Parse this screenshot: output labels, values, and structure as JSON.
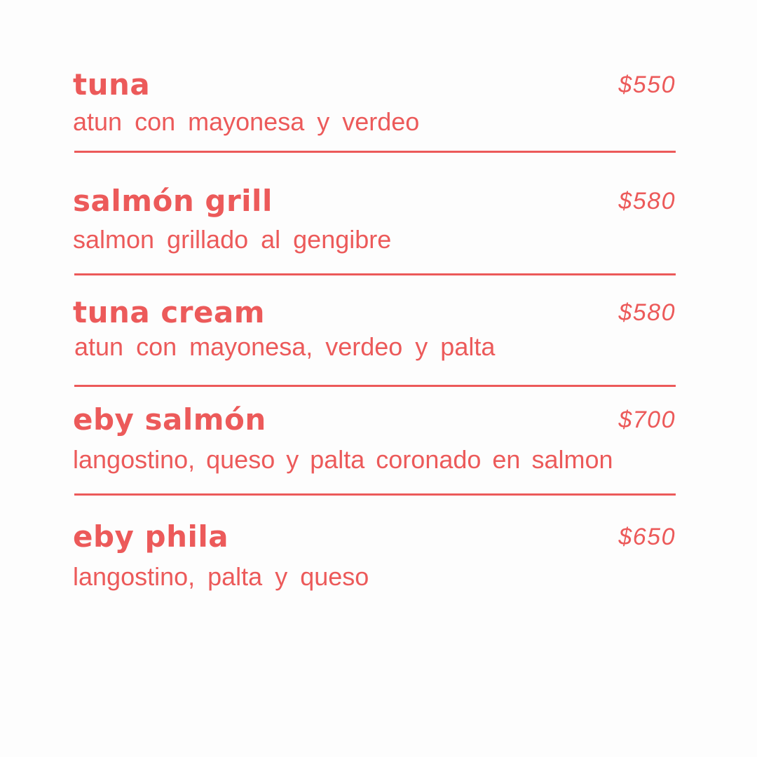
{
  "colors": {
    "accent": "#ec5a5a",
    "background": "#fdfdfd"
  },
  "menu": {
    "items": [
      {
        "name": "tuna",
        "price": "$550",
        "description": "atun con mayonesa y verdeo"
      },
      {
        "name": "salmón grill",
        "price": "$580",
        "description": "salmon grillado al gengibre"
      },
      {
        "name": "tuna cream",
        "price": "$580",
        "description": "atun con mayonesa, verdeo y palta"
      },
      {
        "name": "eby salmón",
        "price": "$700",
        "description": "langostino, queso y palta coronado en salmon"
      },
      {
        "name": "eby phila",
        "price": "$650",
        "description": "langostino, palta y queso"
      }
    ]
  }
}
